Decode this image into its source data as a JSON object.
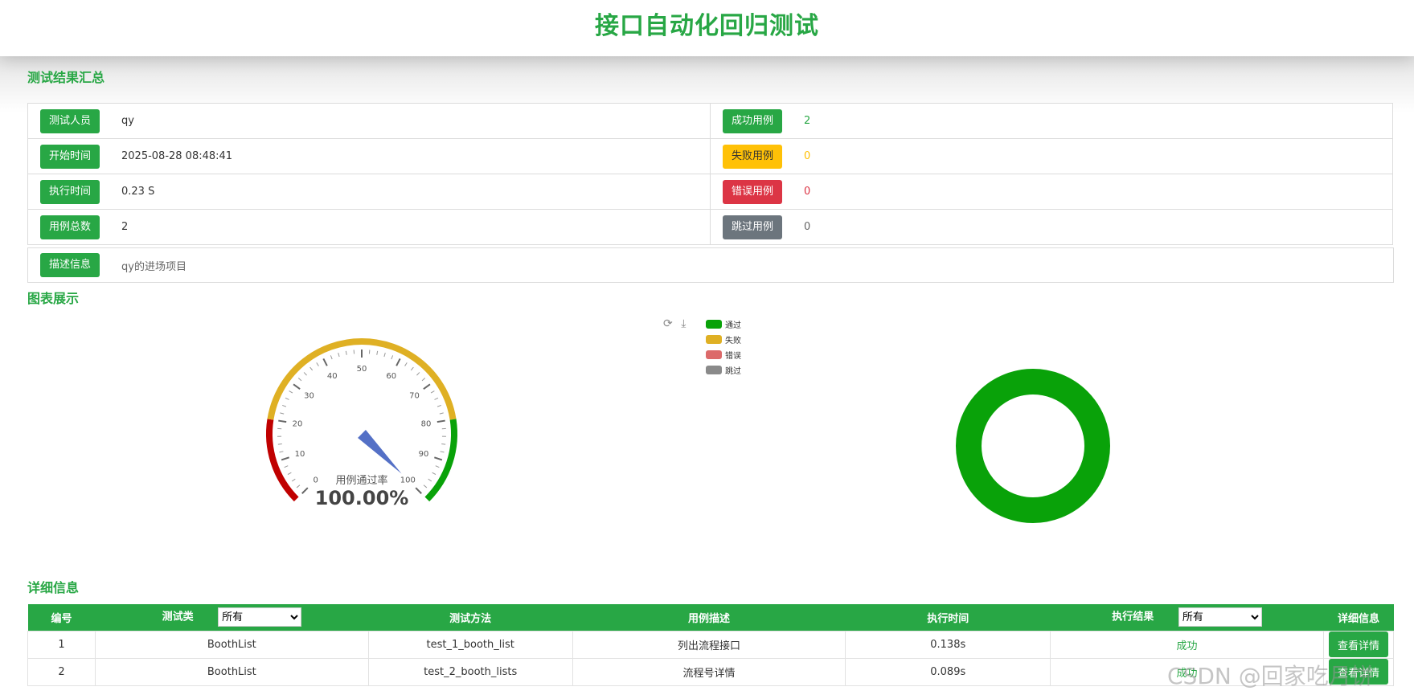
{
  "page": {
    "title": "接口自动化回归测试"
  },
  "sections": {
    "summary": "测试结果汇总",
    "charts": "图表展示",
    "details": "详细信息"
  },
  "summary": {
    "rows": [
      {
        "left_label": "测试人员",
        "left_value": "qy",
        "right_label": "成功用例",
        "right_value": "2"
      },
      {
        "left_label": "开始时间",
        "left_value": "2025-08-28 08:48:41",
        "right_label": "失败用例",
        "right_value": "0"
      },
      {
        "left_label": "执行时间",
        "left_value": "0.23 S",
        "right_label": "错误用例",
        "right_value": "0"
      },
      {
        "left_label": "用例总数",
        "left_value": "2",
        "right_label": "跳过用例",
        "right_value": "0"
      }
    ],
    "desc_label": "描述信息",
    "desc_value": "qy的进场项目",
    "colors": {
      "success": "#28a745",
      "fail": "#ffc107",
      "error": "#dc3545",
      "skip": "#6c757d"
    }
  },
  "toolbox": {
    "refresh_icon": "refresh-icon",
    "download_icon": "download-icon"
  },
  "legend": [
    {
      "label": "通过",
      "color": "#09a209"
    },
    {
      "label": "失败",
      "color": "#dfb024"
    },
    {
      "label": "错误",
      "color": "#dc6a6a"
    },
    {
      "label": "跳过",
      "color": "#8a8a8a"
    }
  ],
  "chart_data": [
    {
      "type": "gauge",
      "title": "用例通过率",
      "value": 100,
      "value_label": "100.00%",
      "min": 0,
      "max": 100,
      "ticks": [
        "0",
        "10",
        "20",
        "30",
        "40",
        "50",
        "60",
        "70",
        "80",
        "90",
        "100"
      ],
      "bands": [
        {
          "from": 0,
          "to": 20,
          "color": "#c00000"
        },
        {
          "from": 20,
          "to": 80,
          "color": "#dfb024"
        },
        {
          "from": 80,
          "to": 100,
          "color": "#09a209"
        }
      ],
      "needle_color": "#5470c6"
    },
    {
      "type": "pie",
      "labels": [
        "通过",
        "失败",
        "错误",
        "跳过"
      ],
      "values": [
        2,
        0,
        0,
        0
      ],
      "colors": [
        "#09a209",
        "#dfb024",
        "#dc6a6a",
        "#8a8a8a"
      ]
    }
  ],
  "table": {
    "headers": [
      "编号",
      "测试类",
      "测试方法",
      "用例描述",
      "执行时间",
      "执行结果",
      "详细信息"
    ],
    "filter_class": "所有",
    "filter_result": "所有",
    "rows": [
      {
        "no": "1",
        "cls": "BoothList",
        "method": "test_1_booth_list",
        "desc": "列出流程接口",
        "time": "0.138s",
        "result": "成功",
        "btn": "查看详情"
      },
      {
        "no": "2",
        "cls": "BoothList",
        "method": "test_2_booth_lists",
        "desc": "流程号详情",
        "time": "0.089s",
        "result": "成功",
        "btn": "查看详情"
      }
    ]
  },
  "watermark": "CSDN @回家吃月饼"
}
